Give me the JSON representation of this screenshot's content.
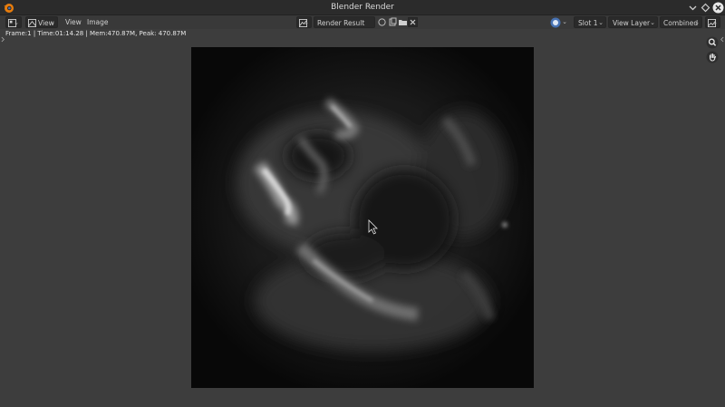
{
  "window": {
    "title": "Blender Render",
    "controls": [
      "minimize-icon",
      "maximize-icon",
      "close-icon"
    ]
  },
  "header": {
    "editor_type_icon": "image-editor-icon",
    "menus": [
      "View",
      "View",
      "Image"
    ],
    "image_name": "Render Result",
    "slot": "Slot 1",
    "view_layer": "View Layer",
    "pass": "Combined"
  },
  "info_bar": {
    "text": "Frame:1 | Time:01:14.28 | Mem:470.87M, Peak: 470.87M"
  },
  "tools": [
    "zoom-icon",
    "hand-pan-icon"
  ],
  "colors": {
    "titlebar": "#2b2b2b",
    "header": "#393939",
    "background": "#3d3d3d",
    "image_background": "#0b0b0b",
    "accent": "#4772b3",
    "logo": "#e87d0d"
  }
}
